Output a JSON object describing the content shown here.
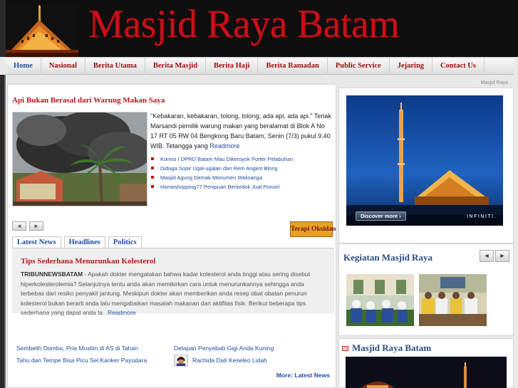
{
  "header": {
    "site_title": "Masjid Raya Batam"
  },
  "nav": [
    "Home",
    "Nasional",
    "Berita Utama",
    "Berita Masjid",
    "Berita Haji",
    "Berita Ramadan",
    "Public Service",
    "Jejaring",
    "Contact Us"
  ],
  "featured": {
    "title": "Api Bukan Berasal dari Warung Makan Saya",
    "text": "\"Kebakaran, kebakaran, tolong, tolong, ada api, ada api.\" Teriak Marsandi pemilik warung makan yang beralamat di Blok A No 17 RT 05 RW 04 Bengkong Baru Batam, Senin (7/3) pukul 9.40 WIB. Tetangga yang ",
    "readmore": "Readmore",
    "related": [
      "Komisi I DPRD Batam Mau Dikeroyok Porter Pelabuhan",
      "Diduga Sopir Ugal-ugalan dan Rem Angkot Blong",
      "Masjid Agung Demak Monumen Walisanga",
      "Homeshopping77 Penipuan Berkedok Jual Ponsel"
    ],
    "prev": "◄",
    "next": "►"
  },
  "banner": {
    "label": "Terapi Oksidan"
  },
  "tabs": [
    "Latest News",
    "Headlines",
    "Politics"
  ],
  "tab_article": {
    "title": "Tips Sederhana Menurunkan Kolesterol",
    "source": "TRIBUNNEWSBATAM",
    "text": " - Apakah dokter mengatakan bahwa kadar kolesterol anda tinggi atau sering disebut hiperkolesterolemia? Selanjutnya tentu anda akan memikirkan cara untuk menurunkannya sehingga anda terbebas dari resiko penyakit jantung. Meskipun dokter akan memberikan anda resep obat obatan penurun kolesterol bukan berarti anda lalu mengabaikan masalah makanan dan aktifitas fisik. Berikut beberapa tips sederhana yang dapat anda la...",
    "readmore": "Readmore"
  },
  "links_left": [
    "Sembelih Domba, Pria Muslim di AS di Tahan",
    "Tahu dan Tempe Bisa Picu Sel Kanker Payudara"
  ],
  "links_right": [
    "Delapan Penyebab Gigi Anda Kuning",
    "Rachida Dati Keseleo Lidah"
  ],
  "more_label": "More: Latest News",
  "sidebar": {
    "widget_label": "Masjid Raya",
    "ad_discover": "Discover more ›",
    "ad_brand": "INFINITI.",
    "kegiatan_title": "Kegiatan Masjid Raya",
    "kegiatan_prev": "◄",
    "kegiatan_next": "►",
    "mrb_title": "Masjid Raya Batam",
    "collapse_glyph": "−"
  },
  "colors": {
    "title_red": "#c8101a",
    "link_blue": "#1f4fa0",
    "heading_red": "#b3171c",
    "widget_blue": "#2c4d84"
  }
}
